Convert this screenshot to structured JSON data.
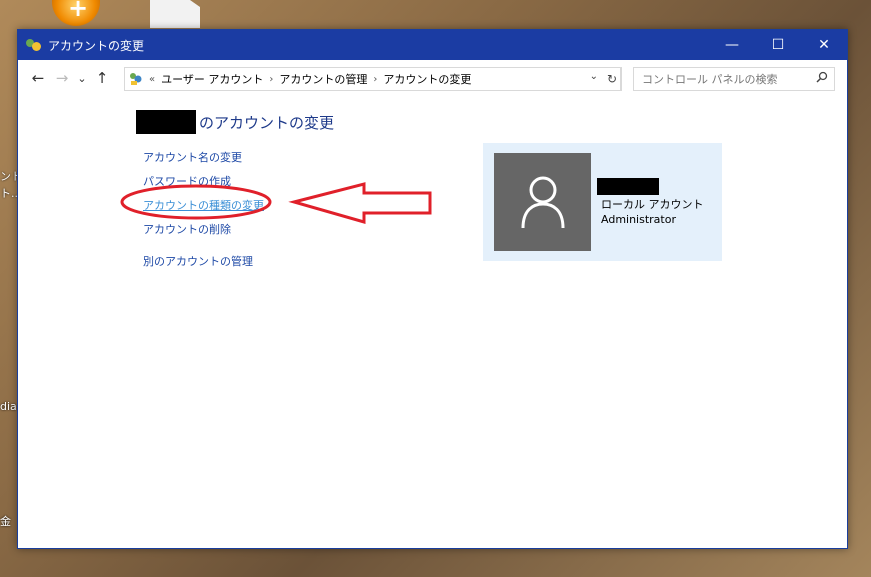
{
  "desktop": {
    "left_texts": [
      "ントを",
      "ト...",
      "dia",
      "金"
    ]
  },
  "window": {
    "title": "アカウントの変更",
    "controls": {
      "minimize": "—",
      "maximize": "☐",
      "close": "✕"
    }
  },
  "navbar": {
    "back": "←",
    "forward": "→",
    "recent": "⌄",
    "up": "↑",
    "breadcrumb_prefix": "«",
    "breadcrumbs": [
      "ユーザー アカウント",
      "アカウントの管理",
      "アカウントの変更"
    ],
    "dropdown": "⌄",
    "refresh": "↻",
    "search_placeholder": "コントロール パネルの検索"
  },
  "content": {
    "heading_suffix": "のアカウントの変更",
    "links": [
      "アカウント名の変更",
      "パスワードの作成",
      "アカウントの種類の変更",
      "アカウントの削除"
    ],
    "other_link": "別のアカウントの管理"
  },
  "account": {
    "type": "ローカル アカウント",
    "role": "Administrator"
  },
  "colors": {
    "titlebar": "#1b3ca3",
    "link": "#1e49a6",
    "annotation": "#e0202a",
    "card_bg": "#e4f0fb"
  }
}
